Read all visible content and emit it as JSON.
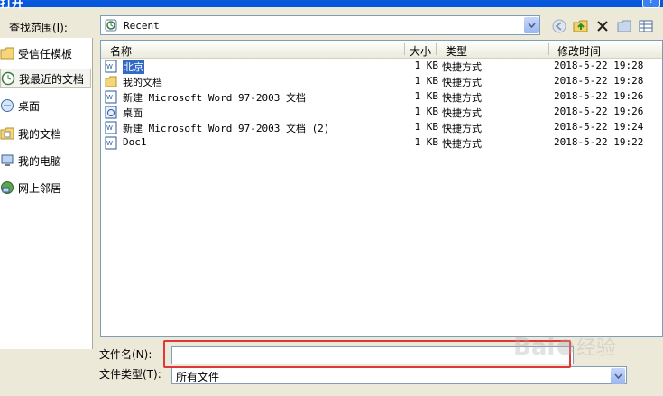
{
  "window": {
    "title": "打开",
    "help_label": "?"
  },
  "lookin": {
    "label": "查找范围(I):",
    "value": "Recent"
  },
  "places": [
    {
      "label": "受信任模板",
      "icon": "folder-icon"
    },
    {
      "label": "我最近的文档",
      "icon": "recent-documents-icon",
      "selected": true
    },
    {
      "label": "桌面",
      "icon": "desktop-icon"
    },
    {
      "label": "我的文档",
      "icon": "my-documents-icon"
    },
    {
      "label": "我的电脑",
      "icon": "computer-icon"
    },
    {
      "label": "网上邻居",
      "icon": "network-icon"
    }
  ],
  "columns": {
    "name": "名称",
    "size": "大小",
    "type": "类型",
    "modified": "修改时间"
  },
  "files": [
    {
      "name": "北京",
      "size": "1 KB",
      "type": "快捷方式",
      "modified": "2018-5-22 19:28",
      "icon": "word-document-icon",
      "selected": true
    },
    {
      "name": "我的文档",
      "size": "1 KB",
      "type": "快捷方式",
      "modified": "2018-5-22 19:28",
      "icon": "folder-icon"
    },
    {
      "name": "新建 Microsoft Word 97-2003 文档",
      "size": "1 KB",
      "type": "快捷方式",
      "modified": "2018-5-22 19:26",
      "icon": "word-document-icon"
    },
    {
      "name": "桌面",
      "size": "1 KB",
      "type": "快捷方式",
      "modified": "2018-5-22 19:26",
      "icon": "desktop-shortcut-icon"
    },
    {
      "name": "新建 Microsoft Word 97-2003 文档 (2)",
      "size": "1 KB",
      "type": "快捷方式",
      "modified": "2018-5-22 19:24",
      "icon": "word-document-icon"
    },
    {
      "name": "Doc1",
      "size": "1 KB",
      "type": "快捷方式",
      "modified": "2018-5-22 19:22",
      "icon": "word-document-icon"
    }
  ],
  "filename": {
    "label": "文件名(N):",
    "value": ""
  },
  "filetype": {
    "label": "文件类型(T):",
    "value": "所有文件"
  },
  "colors": {
    "highlight": "#e0373a",
    "selection": "#316ac5",
    "titlebar": "#0454e2"
  }
}
